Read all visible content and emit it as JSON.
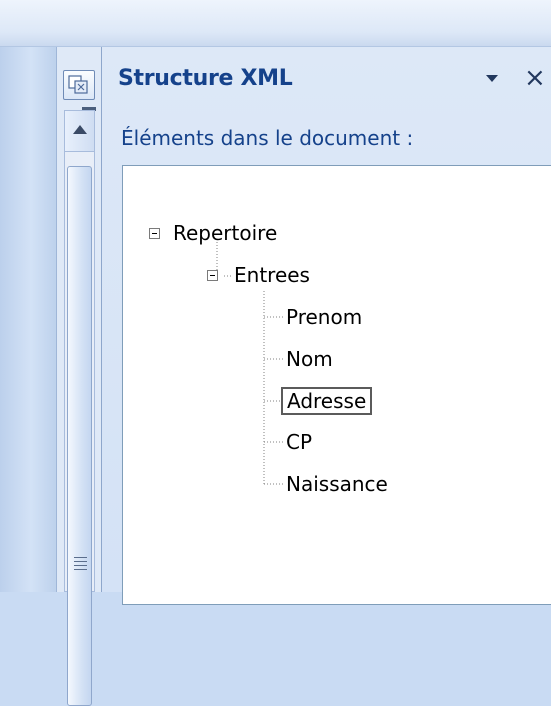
{
  "pane": {
    "title": "Structure XML",
    "close_label": "×",
    "subtitle": "Éléments dans le document :"
  },
  "tree": {
    "root": "Repertoire",
    "child": "Entrees",
    "leaves": [
      "Prenom",
      "Nom",
      "Adresse",
      "CP",
      "Naissance"
    ],
    "selected": "Adresse"
  },
  "icons": {
    "panel": "xml-structure-icon",
    "dropdown": "dropdown-arrow-icon",
    "close": "close-icon",
    "scroll_up": "scroll-up-arrow-icon",
    "expander": "collapse-minus-icon"
  },
  "colors": {
    "title_text": "#15428b",
    "pane_background": "#dde8f7",
    "tree_border": "#7f9db9"
  }
}
